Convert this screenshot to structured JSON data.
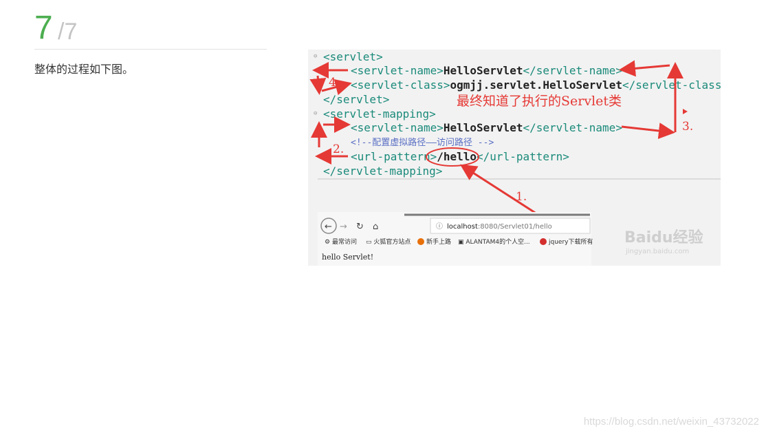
{
  "step": {
    "current": "7",
    "total": "/7"
  },
  "description": "整体的过程如下图。",
  "figure": {
    "xml_lines": [
      {
        "tag": "<servlet>"
      },
      {
        "open": "<servlet-name>",
        "value": "HelloServlet",
        "close": "</servlet-name>"
      },
      {
        "open": "<servlet-class>",
        "value": "ogmjj.servlet.HelloServlet",
        "close": "</servlet-class>"
      },
      {
        "tag": "</servlet>"
      },
      {
        "tag": "<servlet-mapping>"
      },
      {
        "open": "<servlet-name>",
        "value": "HelloServlet",
        "close": "</servlet-name>"
      },
      {
        "comment": "<!--配置虚拟路径——访问路径 -->"
      },
      {
        "open": "<url-pattern>",
        "value": "/hello",
        "close": "</url-pattern>"
      },
      {
        "tag": "</servlet-mapping>"
      }
    ],
    "annotation_text": "最终知道了执行的Servlet类",
    "step_labels": {
      "s1": "1.",
      "s2": "2.",
      "s3": "3.",
      "s4": "4."
    },
    "browser": {
      "url_host": "localhost",
      "url_rest": ":8080/Servlet01/hello",
      "bookmarks": [
        "最常访问",
        "火狐官方站点",
        "新手上路",
        "ALANTAM4的个人空...",
        "jquery下载所有"
      ],
      "page_text": "hello Servlet!"
    },
    "baidu_watermark": {
      "logo": "Baidu经验",
      "url": "jingyan.baidu.com"
    }
  },
  "watermark_url": "https://blog.csdn.net/weixin_43732022",
  "colors": {
    "step_green": "#4cae4f",
    "annotation_red": "#e53935",
    "xml_tag": "#1a8a7a"
  }
}
